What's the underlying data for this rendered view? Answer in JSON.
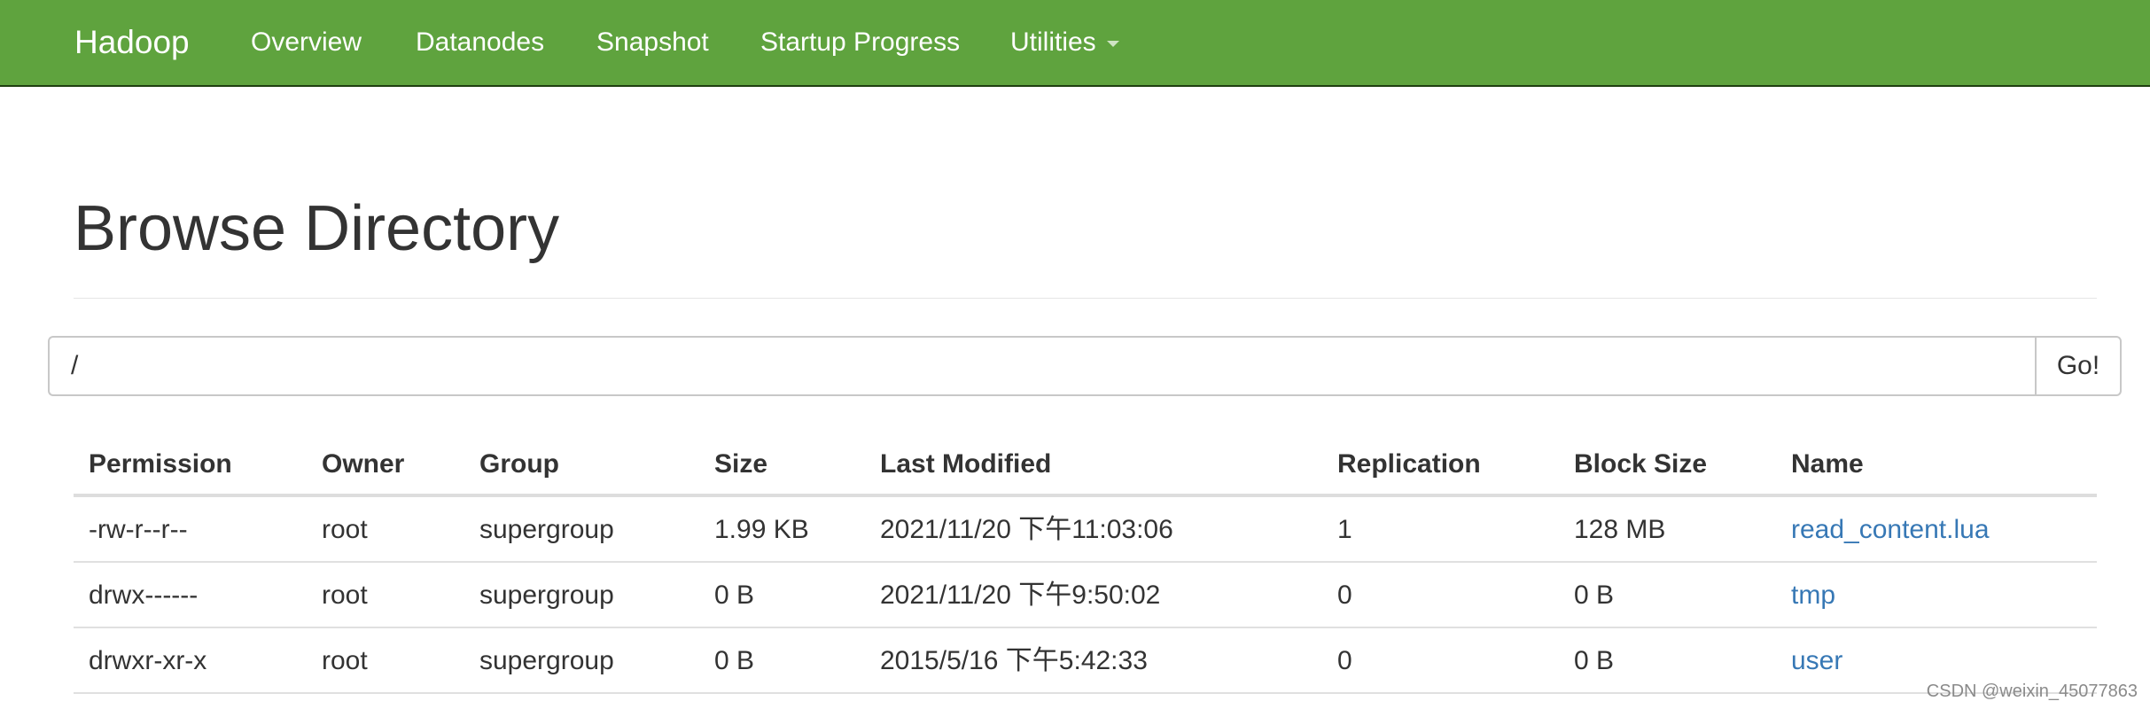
{
  "navbar": {
    "brand": "Hadoop",
    "items": [
      "Overview",
      "Datanodes",
      "Snapshot",
      "Startup Progress",
      "Utilities"
    ],
    "background_color": "#5fa33e"
  },
  "page": {
    "title": "Browse Directory"
  },
  "path_bar": {
    "value": "/",
    "go_label": "Go!"
  },
  "table": {
    "headers": [
      "Permission",
      "Owner",
      "Group",
      "Size",
      "Last Modified",
      "Replication",
      "Block Size",
      "Name"
    ],
    "rows": [
      [
        "-rw-r--r--",
        "root",
        "supergroup",
        "1.99 KB",
        "2021/11/20 下午11:03:06",
        "1",
        "128 MB",
        "read_content.lua"
      ],
      [
        "drwx------",
        "root",
        "supergroup",
        "0 B",
        "2021/11/20 下午9:50:02",
        "0",
        "0 B",
        "tmp"
      ],
      [
        "drwxr-xr-x",
        "root",
        "supergroup",
        "0 B",
        "2015/5/16 下午5:42:33",
        "0",
        "0 B",
        "user"
      ]
    ],
    "link_color": "#3778b5"
  },
  "watermark": "CSDN @weixin_45077863"
}
